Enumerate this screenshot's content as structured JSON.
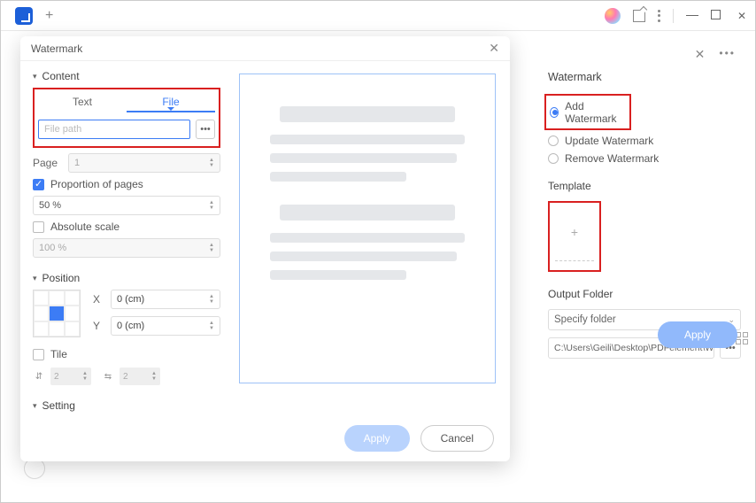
{
  "titlebar": {
    "plus": "+"
  },
  "modal": {
    "title": "Watermark",
    "content_label": "Content",
    "tabs": {
      "text": "Text",
      "file": "File"
    },
    "file_placeholder": "File path",
    "page_label": "Page",
    "page_value": "1",
    "proportion_label": "Proportion of pages",
    "proportion_value": "50 %",
    "absolute_label": "Absolute scale",
    "absolute_value": "100 %",
    "position_label": "Position",
    "x_label": "X",
    "x_value": "0 (cm)",
    "y_label": "Y",
    "y_value": "0 (cm)",
    "tile_label": "Tile",
    "tile_h": "2",
    "tile_v": "2",
    "setting_label": "Setting",
    "apply": "Apply",
    "cancel": "Cancel"
  },
  "right": {
    "title": "Watermark",
    "radios": {
      "add": "Add Watermark",
      "update": "Update Watermark",
      "remove": "Remove Watermark"
    },
    "template_label": "Template",
    "output_label": "Output Folder",
    "specify": "Specify folder",
    "path": "C:\\Users\\Geili\\Desktop\\PDFelement\\W",
    "apply": "Apply"
  }
}
